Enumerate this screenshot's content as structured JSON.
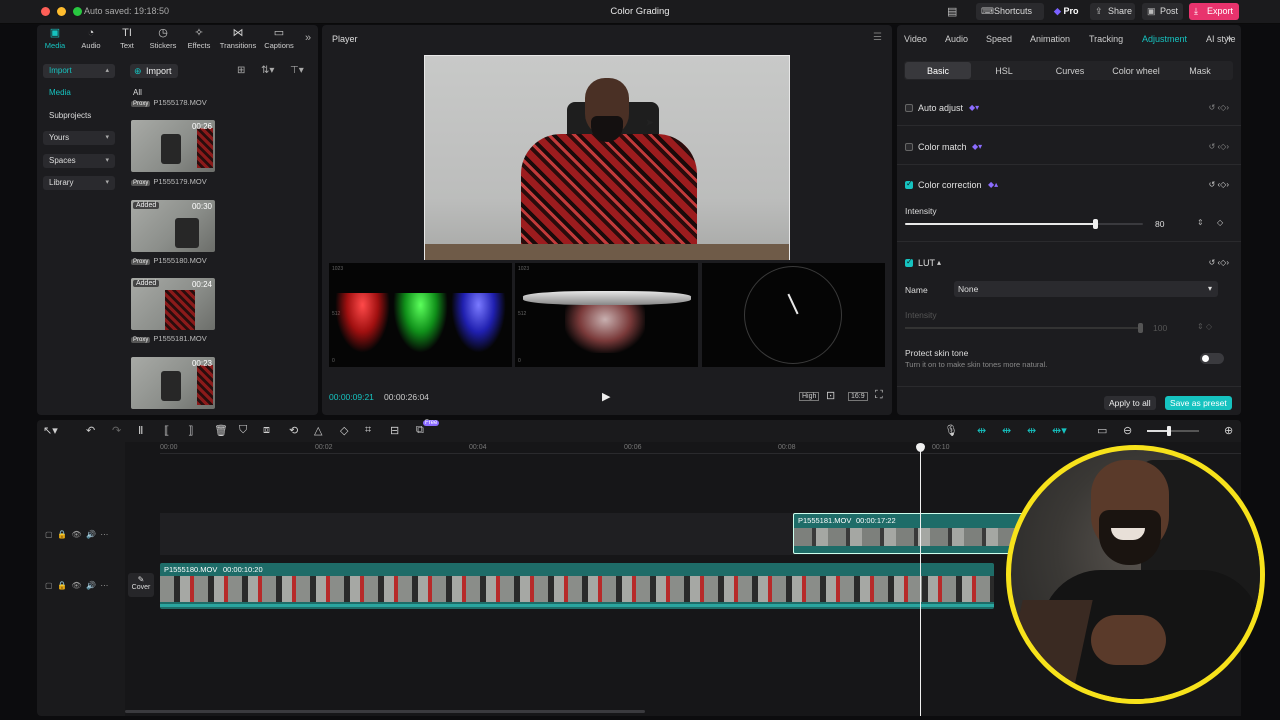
{
  "titlebar": {
    "autosave": "Auto saved: 19:18:50",
    "title": "Color Grading",
    "shortcuts": "Shortcuts",
    "pro": "Pro",
    "share": "Share",
    "post": "Post",
    "export": "Export",
    "colors": {
      "export": "#e8336d",
      "pro": "#7b61ff"
    }
  },
  "left": {
    "tools": [
      {
        "label": "Media",
        "icon": "media-icon"
      },
      {
        "label": "Audio",
        "icon": "audio-icon"
      },
      {
        "label": "Text",
        "icon": "text-icon"
      },
      {
        "label": "Stickers",
        "icon": "stickers-icon"
      },
      {
        "label": "Effects",
        "icon": "effects-icon"
      },
      {
        "label": "Transitions",
        "icon": "transitions-icon"
      },
      {
        "label": "Captions",
        "icon": "captions-icon"
      }
    ],
    "nav": [
      {
        "label": "Import"
      },
      {
        "label": "Media"
      },
      {
        "label": "Subprojects"
      },
      {
        "label": "Yours"
      },
      {
        "label": "Spaces"
      },
      {
        "label": "Library"
      }
    ],
    "import_button": "Import",
    "filter_all": "All",
    "media_items": [
      {
        "name": "P1555178.MOV",
        "proxy": "Proxy",
        "duration": "",
        "added": ""
      },
      {
        "name": "P1555179.MOV",
        "proxy": "Proxy",
        "duration": "00:26",
        "added": ""
      },
      {
        "name": "P1555180.MOV",
        "proxy": "Proxy",
        "duration": "00:30",
        "added": "Added"
      },
      {
        "name": "P1555181.MOV",
        "proxy": "Proxy",
        "duration": "00:24",
        "added": "Added"
      },
      {
        "name": "",
        "proxy": "",
        "duration": "00:23",
        "added": ""
      }
    ]
  },
  "player": {
    "title": "Player",
    "current_time": "00:00:09:21",
    "total_time": "00:00:26:04",
    "quality": "High",
    "ratio": "16:9",
    "scope_labels": [
      "1023",
      "512",
      "0"
    ]
  },
  "right": {
    "tabs": [
      "Video",
      "Audio",
      "Speed",
      "Animation",
      "Tracking",
      "Adjustment",
      "AI style"
    ],
    "active_tab": "Adjustment",
    "subtabs": [
      "Basic",
      "HSL",
      "Curves",
      "Color wheel",
      "Mask"
    ],
    "auto_adjust": "Auto adjust",
    "color_match": "Color match",
    "color_correction": "Color correction",
    "intensity_label": "Intensity",
    "intensity_value": "80",
    "intensity_level": 0.8,
    "lut": "LUT",
    "name_label": "Name",
    "name_value": "None",
    "lut_intensity_label": "Intensity",
    "lut_intensity_value": "100",
    "protect_skin": "Protect skin tone",
    "protect_skin_desc": "Turn it on to make skin tones more natural.",
    "apply_all": "Apply to all",
    "save_preset": "Save as preset",
    "accent": "#16c3c0"
  },
  "timeline": {
    "free_badge": "Free",
    "ruler": [
      "00:00",
      "00:02",
      "00:04",
      "00:06",
      "00:08",
      "00:10"
    ],
    "clip_top": {
      "name": "P1555181.MOV",
      "duration": "00:00:17:22"
    },
    "clip_main": {
      "name": "P1555180.MOV",
      "duration": "00:00:10:20"
    },
    "cover_label": "Cover"
  }
}
